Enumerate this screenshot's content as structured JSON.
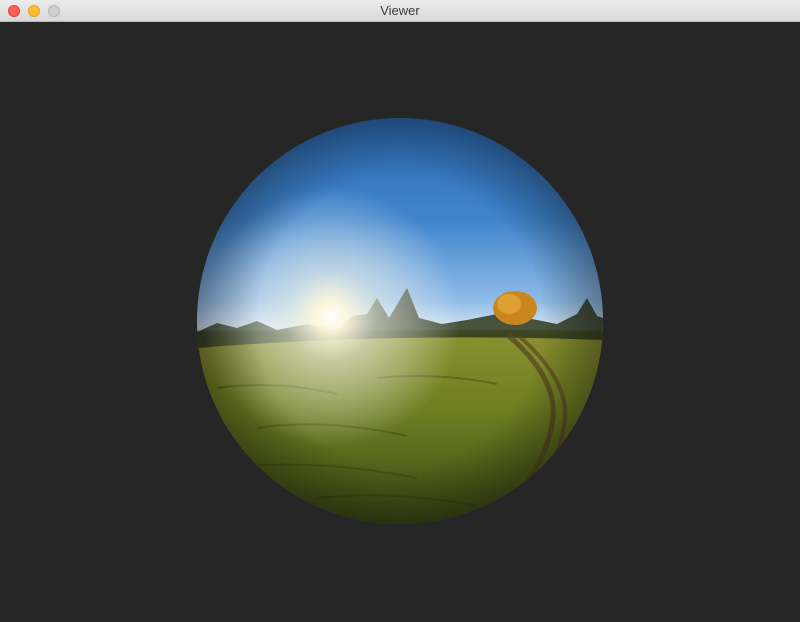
{
  "window": {
    "title": "Viewer",
    "background_color": "#262626"
  },
  "titlebar": {
    "buttons": [
      {
        "name": "close",
        "color": "#fe5f57"
      },
      {
        "name": "minimize",
        "color": "#febc2e"
      },
      {
        "name": "zoom",
        "color": "#cfcfcf"
      }
    ]
  },
  "scene": {
    "content": "panorama-sphere",
    "sky_color": "#3d7fc6",
    "horizon_glow_color": "#fff7d6",
    "grass_color": "#6e7a26",
    "tree_autumn_color": "#d08a1e"
  }
}
